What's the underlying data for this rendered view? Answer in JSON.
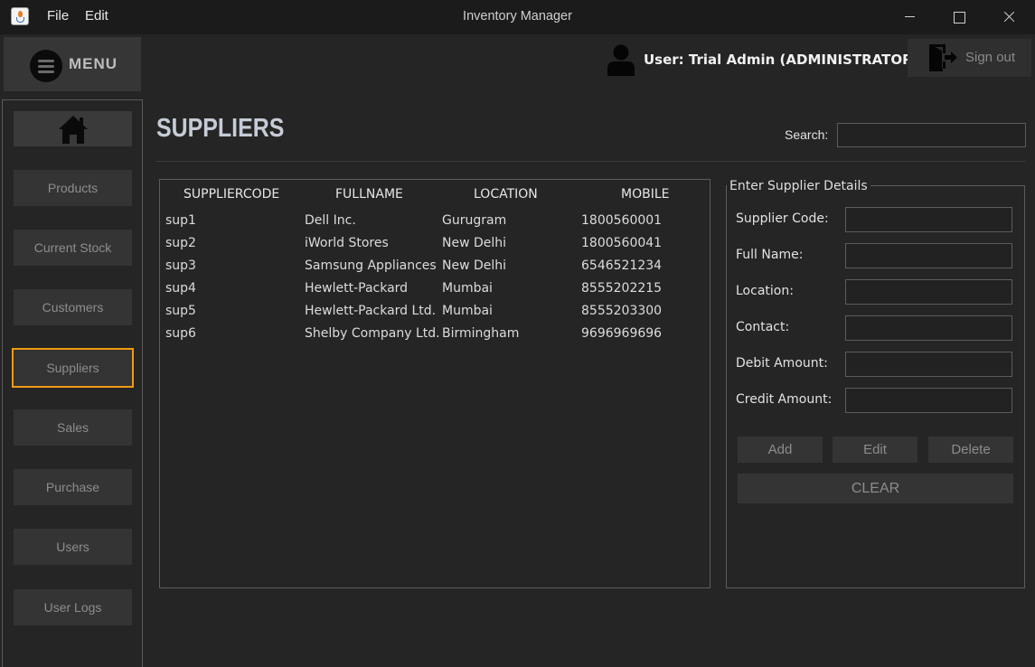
{
  "window": {
    "title": "Inventory Manager",
    "menus": [
      "File",
      "Edit"
    ]
  },
  "menu": {
    "label": "MENU"
  },
  "sidebar": {
    "items": [
      {
        "label": "Products"
      },
      {
        "label": "Current Stock"
      },
      {
        "label": "Customers"
      },
      {
        "label": "Suppliers",
        "active": true
      },
      {
        "label": "Sales"
      },
      {
        "label": "Purchase"
      },
      {
        "label": "Users"
      },
      {
        "label": "User Logs"
      }
    ]
  },
  "header": {
    "user_text": "User: Trial Admin (ADMINISTRATOR)",
    "signout_label": "Sign out"
  },
  "page": {
    "title": "SUPPLIERS",
    "search_label": "Search:",
    "search_value": ""
  },
  "table": {
    "columns": [
      "SUPPLIERCODE",
      "FULLNAME",
      "LOCATION",
      "MOBILE"
    ],
    "rows": [
      [
        "sup1",
        "Dell Inc.",
        "Gurugram",
        "1800560001"
      ],
      [
        "sup2",
        "iWorld Stores",
        "New Delhi",
        "1800560041"
      ],
      [
        "sup3",
        "Samsung Appliances",
        "New Delhi",
        "6546521234"
      ],
      [
        "sup4",
        "Hewlett-Packard",
        "Mumbai",
        "8555202215"
      ],
      [
        "sup5",
        "Hewlett-Packard Ltd.",
        "Mumbai",
        "8555203300"
      ],
      [
        "sup6",
        "Shelby Company Ltd.",
        "Birmingham",
        "9696969696"
      ]
    ]
  },
  "details": {
    "legend": "Enter Supplier Details",
    "fields": [
      {
        "label": "Supplier Code:",
        "value": ""
      },
      {
        "label": "Full Name:",
        "value": ""
      },
      {
        "label": "Location:",
        "value": ""
      },
      {
        "label": "Contact:",
        "value": ""
      },
      {
        "label": "Debit Amount:",
        "value": ""
      },
      {
        "label": "Credit Amount:",
        "value": ""
      }
    ],
    "buttons": {
      "add": "Add",
      "edit": "Edit",
      "delete": "Delete",
      "clear": "CLEAR"
    }
  },
  "colors": {
    "accent_active": "#f19a14",
    "background": "#252525",
    "title_text": "#c6ccd6"
  }
}
